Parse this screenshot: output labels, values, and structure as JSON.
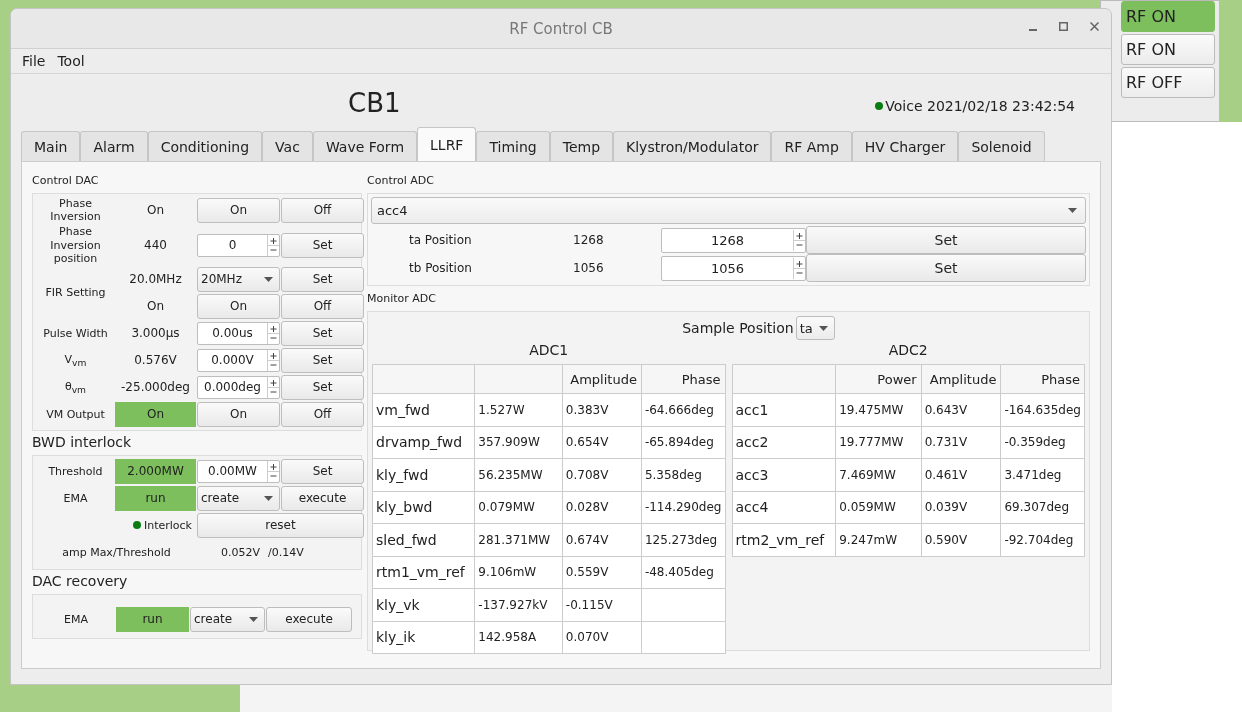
{
  "background_window": {
    "buttons": [
      {
        "label": "RF ON",
        "active": true
      },
      {
        "label": "RF ON",
        "active": false
      },
      {
        "label": "RF OFF",
        "active": false
      }
    ]
  },
  "window": {
    "title": "RF Control CB"
  },
  "menu": [
    "File",
    "Tool"
  ],
  "header": {
    "title": "CB1",
    "status": {
      "on": true,
      "label": "Voice 2021/02/18 23:42:54"
    }
  },
  "tabs": [
    {
      "label": "Main",
      "selected": false
    },
    {
      "label": "Alarm",
      "selected": false
    },
    {
      "label": "Conditioning",
      "selected": false
    },
    {
      "label": "Vac",
      "selected": false
    },
    {
      "label": "Wave Form",
      "selected": false
    },
    {
      "label": "LLRF",
      "selected": true
    },
    {
      "label": "Timing",
      "selected": false
    },
    {
      "label": "Temp",
      "selected": false
    },
    {
      "label": "Klystron/Modulator",
      "selected": false
    },
    {
      "label": "RF Amp",
      "selected": false
    },
    {
      "label": "HV Charger",
      "selected": false
    },
    {
      "label": "Solenoid",
      "selected": false
    }
  ],
  "control_dac": {
    "title": "Control DAC",
    "rows": [
      {
        "label": "Phase Inversion",
        "lines": [
          {
            "reading": "On",
            "active": false,
            "kind": "toggle",
            "buttons": [
              "On",
              "Off"
            ]
          }
        ]
      },
      {
        "label": "Phase Inversion position",
        "lines": [
          {
            "reading": "440",
            "active": false,
            "kind": "spin",
            "value": "0",
            "buttons": [
              "Set"
            ]
          }
        ]
      },
      {
        "label": "FIR Setting",
        "lines": [
          {
            "reading": "20.0MHz",
            "active": false,
            "kind": "combo",
            "value": "20MHz",
            "buttons": [
              "Set"
            ]
          },
          {
            "reading": "On",
            "active": false,
            "kind": "toggle",
            "buttons": [
              "On",
              "Off"
            ]
          }
        ]
      },
      {
        "label": "Pulse Width",
        "lines": [
          {
            "reading": "3.000µs",
            "active": false,
            "kind": "spin",
            "value": "0.00us",
            "buttons": [
              "Set"
            ]
          }
        ]
      },
      {
        "label": "V$_{vm}$",
        "lines": [
          {
            "reading": "0.576V",
            "active": false,
            "kind": "spin",
            "value": "0.000V",
            "buttons": [
              "Set"
            ]
          }
        ]
      },
      {
        "label": "θ$_{vm}$",
        "lines": [
          {
            "reading": "-25.000deg",
            "active": false,
            "kind": "spin",
            "value": "0.000deg",
            "buttons": [
              "Set"
            ]
          }
        ]
      },
      {
        "label": "VM Output",
        "lines": [
          {
            "reading": "On",
            "active": true,
            "kind": "toggle",
            "buttons": [
              "On",
              "Off"
            ]
          }
        ]
      }
    ]
  },
  "bwd_interlock": {
    "title": "BWD interlock",
    "rows": [
      {
        "label": "Threshold",
        "lines": [
          {
            "reading": "2.000MW",
            "active": true,
            "kind": "spin",
            "value": "0.00MW",
            "buttons": [
              "Set"
            ]
          }
        ]
      },
      {
        "label": "EMA",
        "lines": [
          {
            "reading": "run",
            "active": true,
            "kind": "combo",
            "value": "create",
            "buttons": [
              "execute"
            ]
          }
        ]
      }
    ],
    "interlock": {
      "on": true,
      "label": "Interlock",
      "button": "reset"
    },
    "readout": {
      "label": "amp Max/Threshold",
      "value": "0.052V",
      "limit": "/0.14V"
    }
  },
  "dac_recovery": {
    "title": "DAC recovery",
    "rows": [
      {
        "label": "EMA",
        "lines": [
          {
            "reading": "run",
            "active": true,
            "kind": "combo",
            "value": "create",
            "buttons": [
              "execute"
            ]
          }
        ]
      }
    ]
  },
  "control_adc": {
    "title": "Control ADC",
    "target": "acc4",
    "positions": [
      {
        "label": "ta Position",
        "reading": "1268",
        "value": "1268",
        "button": "Set"
      },
      {
        "label": "tb Position",
        "reading": "1056",
        "value": "1056",
        "button": "Set"
      }
    ]
  },
  "monitor_adc": {
    "title": "Monitor ADC",
    "sample_position": {
      "label": "Sample Position",
      "value": "ta"
    },
    "tables": [
      {
        "title": "ADC1",
        "columns": [
          "",
          "",
          "Amplitude",
          "Phase"
        ],
        "rows": [
          [
            "vm_fwd",
            "1.527W",
            "0.383V",
            "-64.666deg"
          ],
          [
            "drvamp_fwd",
            "357.909W",
            "0.654V",
            "-65.894deg"
          ],
          [
            "kly_fwd",
            "56.235MW",
            "0.708V",
            "5.358deg"
          ],
          [
            "kly_bwd",
            "0.079MW",
            "0.028V",
            "-114.290deg"
          ],
          [
            "sled_fwd",
            "281.371MW",
            "0.674V",
            "125.273deg"
          ],
          [
            "rtm1_vm_ref",
            "9.106mW",
            "0.559V",
            "-48.405deg"
          ],
          [
            "kly_vk",
            "-137.927kV",
            "-0.115V"
          ],
          [
            "kly_ik",
            "142.958A",
            "0.070V"
          ]
        ]
      },
      {
        "title": "ADC2",
        "columns": [
          "",
          "Power",
          "Amplitude",
          "Phase"
        ],
        "rows": [
          [
            "acc1",
            "19.475MW",
            "0.643V",
            "-164.635deg"
          ],
          [
            "acc2",
            "19.777MW",
            "0.731V",
            "-0.359deg"
          ],
          [
            "acc3",
            "7.469MW",
            "0.461V",
            "3.471deg"
          ],
          [
            "acc4",
            "0.059MW",
            "0.039V",
            "69.307deg"
          ],
          [
            "rtm2_vm_ref",
            "9.247mW",
            "0.590V",
            "-92.704deg"
          ]
        ]
      }
    ]
  }
}
